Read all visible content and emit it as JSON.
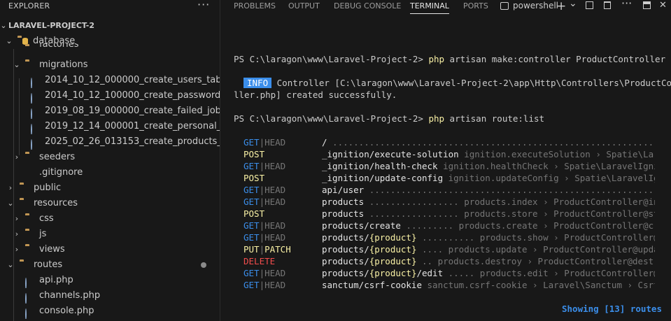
{
  "explorer": {
    "title": "EXPLORER",
    "more": "···",
    "project": "LARAVEL-PROJECT-2",
    "items": [
      {
        "label": "database",
        "chev": "⌄"
      },
      {
        "label": "factories",
        "chev": "›"
      },
      {
        "label": "migrations",
        "chev": "⌄"
      },
      {
        "label": "2014_10_12_000000_create_users_table.p..."
      },
      {
        "label": "2014_10_12_100000_create_password_res..."
      },
      {
        "label": "2019_08_19_000000_create_failed_jobs_ta..."
      },
      {
        "label": "2019_12_14_000001_create_personal_acc..."
      },
      {
        "label": "2025_02_26_013153_create_products_tabl..."
      },
      {
        "label": "seeders",
        "chev": "›"
      },
      {
        "label": ".gitignore"
      },
      {
        "label": "public",
        "chev": "›"
      },
      {
        "label": "resources",
        "chev": "⌄"
      },
      {
        "label": "css",
        "chev": "›"
      },
      {
        "label": "js",
        "chev": "›"
      },
      {
        "label": "views",
        "chev": "›"
      },
      {
        "label": "routes",
        "chev": "⌄"
      },
      {
        "label": "api.php"
      },
      {
        "label": "channels.php"
      },
      {
        "label": "console.php"
      }
    ]
  },
  "tabs": [
    "PROBLEMS",
    "OUTPUT",
    "DEBUG CONSOLE",
    "TERMINAL",
    "PORTS"
  ],
  "active_tab": "TERMINAL",
  "terminal_profile": "powershell",
  "toolbar": {
    "add": "+",
    "split": "⌄",
    "more": "···",
    "close": "✕"
  },
  "terminal": {
    "prompt": "PS C:\\laragon\\www\\Laravel-Project-2> ",
    "cmd1": "php artisan make:controller ProductController",
    "info_badge": "INFO",
    "info_line1": "Controller [C:\\laragon\\www\\Laravel-Project-2\\app\\Http\\Controllers\\ProductContro",
    "info_line2": "ller.php] created successfully.",
    "cmd2": "php artisan route:list",
    "routes": [
      {
        "m1": "GET",
        "m2": "HEAD",
        "c1": "blue",
        "c2": "gray",
        "uri": "/",
        "param": "",
        "tail": "",
        "rest": " .............................................................................."
      },
      {
        "m1": "POST",
        "m2": "",
        "c1": "yellow",
        "c2": "",
        "uri": "_ignition/execute-solution",
        "param": "",
        "tail": "",
        "rest": " ignition.executeSolution › Spatie\\LaravelIgnition"
      },
      {
        "m1": "GET",
        "m2": "HEAD",
        "c1": "blue",
        "c2": "gray",
        "uri": "_ignition/health-check",
        "param": "",
        "tail": "",
        "rest": " ignition.healthCheck › Spatie\\LaravelIgnition"
      },
      {
        "m1": "POST",
        "m2": "",
        "c1": "yellow",
        "c2": "",
        "uri": "_ignition/update-config",
        "param": "",
        "tail": "",
        "rest": " ignition.updateConfig › Spatie\\LaravelIgnition"
      },
      {
        "m1": "GET",
        "m2": "HEAD",
        "c1": "blue",
        "c2": "gray",
        "uri": "api/user",
        "param": "",
        "tail": "",
        "rest": " ........................................................................"
      },
      {
        "m1": "GET",
        "m2": "HEAD",
        "c1": "blue",
        "c2": "gray",
        "uri": "products",
        "param": "",
        "tail": "",
        "rest": " ................. products.index › ProductController@index"
      },
      {
        "m1": "POST",
        "m2": "",
        "c1": "yellow",
        "c2": "",
        "uri": "products",
        "param": "",
        "tail": "",
        "rest": " ................. products.store › ProductController@store"
      },
      {
        "m1": "GET",
        "m2": "HEAD",
        "c1": "blue",
        "c2": "gray",
        "uri": "products/create",
        "param": "",
        "tail": "",
        "rest": " ......... products.create › ProductController@create"
      },
      {
        "m1": "GET",
        "m2": "HEAD",
        "c1": "blue",
        "c2": "gray",
        "uri": "products/",
        "param": "{product}",
        "tail": "",
        "rest": " .......... products.show › ProductController@show"
      },
      {
        "m1": "PUT",
        "m2": "PATCH",
        "c1": "yellow",
        "c2": "yellow",
        "uri": "products/",
        "param": "{product}",
        "tail": "",
        "rest": " .... products.update › ProductController@update"
      },
      {
        "m1": "DELETE",
        "m2": "",
        "c1": "red",
        "c2": "",
        "uri": "products/",
        "param": "{product}",
        "tail": "",
        "rest": " .. products.destroy › ProductController@destroy"
      },
      {
        "m1": "GET",
        "m2": "HEAD",
        "c1": "blue",
        "c2": "gray",
        "uri": "products/",
        "param": "{product}",
        "tail": "/edit",
        "rest": " ..... products.edit › ProductController@edit"
      },
      {
        "m1": "GET",
        "m2": "HEAD",
        "c1": "blue",
        "c2": "gray",
        "uri": "sanctum/csrf-cookie",
        "param": "",
        "tail": "",
        "rest": " sanctum.csrf-cookie › Laravel\\Sanctum › CsrfCookieController@show"
      }
    ],
    "showing": "Showing [13] routes"
  }
}
